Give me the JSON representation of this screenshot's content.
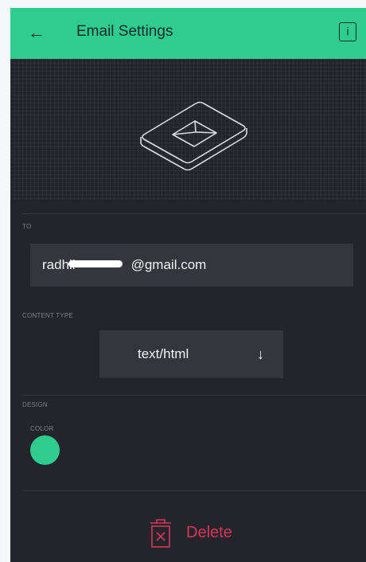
{
  "app_bar": {
    "title": "Email Settings",
    "back_icon": "arrow-left-icon",
    "info_icon": "info-icon",
    "info_glyph": "i",
    "background": "#2ecc8f"
  },
  "hero": {
    "icon": "envelope-tile-icon"
  },
  "to_section": {
    "label": "TO",
    "value": "radhil██████@gmail.com",
    "value_prefix": "radhil",
    "value_suffix": "@gmail.com"
  },
  "content_type_section": {
    "label": "CONTENT TYPE",
    "selected": "text/html",
    "arrow_icon": "arrow-down-icon",
    "arrow_glyph": "↓"
  },
  "design_section": {
    "label": "DESIGN",
    "color_label": "COLOR",
    "color": "#2ecc8f"
  },
  "delete": {
    "label": "Delete",
    "icon": "trash-icon",
    "color": "#d6365b"
  }
}
